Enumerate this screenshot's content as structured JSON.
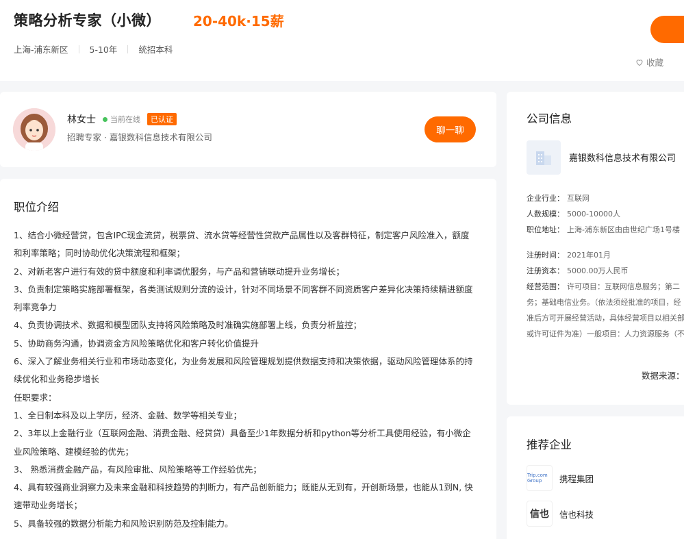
{
  "job": {
    "title": "策略分析专家（小微）",
    "salary": "20-40k·15薪",
    "location": "上海-浦东新区",
    "experience": "5-10年",
    "education": "统招本科",
    "favorite_label": "收藏"
  },
  "recruiter": {
    "name": "林女士",
    "status": "当前在线",
    "badge": "已认证",
    "subtitle": "招聘专家 · 嘉银数科信息技术有限公司",
    "chat_label": "聊一聊"
  },
  "description": {
    "title": "职位介绍",
    "lines": [
      "1、结合小微经营贷，包含IPC现金流贷，税票贷、流水贷等经营性贷款产品属性以及客群特征，制定客户风险准入，额度和利率策略；同时协助优化决策流程和框架；",
      "2、对新老客户进行有效的贷中额度和利率调优服务，与产品和营销联动提升业务增长；",
      "3、负责制定策略实施部署框架，各类测试规则分流的设计，针对不同场景不同客群不同资质客户差异化决策持续精进额度利率竞争力",
      "4、负责协调技术、数据和模型团队支持将风险策略及时准确实施部署上线，负责分析监控；",
      "5、协助商务沟通，协调资金方风险策略优化和客户转化价值提升",
      "6、深入了解业务相关行业和市场动态变化，为业务发展和风险管理规划提供数据支持和决策依据，驱动风险管理体系的持续优化和业务稳步增长",
      "任职要求：",
      "1、全日制本科及以上学历，经济、金融、数学等相关专业；",
      "2、3年以上金融行业（互联网金融、消费金融、经贷贷）具备至少1年数据分析和python等分析工具使用经验，有小微企业风险策略、建模经验的优先；",
      "3、 熟悉消费金融产品，有风险审批、风险策略等工作经验优先；",
      "4、具有较强商业洞察力及未来金融和科技趋势的判断力，有产品创新能力；既能从无到有，开创新场景，也能从1到N, 快速带动业务增长；",
      "5、具备较强的数据分析能力和风险识别防范及控制能力。"
    ]
  },
  "company": {
    "title": "公司信息",
    "name": "嘉银数科信息技术有限公司",
    "industry_label": "企业行业：",
    "industry": "互联网",
    "size_label": "人数规模：",
    "size": "5000-10000人",
    "address_label": "职位地址：",
    "address": "上海-浦东新区由由世纪广场1号楼",
    "reg_date_label": "注册时间：",
    "reg_date": "2021年01月",
    "capital_label": "注册资本：",
    "capital": "5000.00万人民币",
    "scope_label": "经营范围：",
    "scope_lines": [
      "许可项目：互联网信息服务；第二",
      "务；基础电信业务。（依法须经批准的项目，经",
      "准后方可开展经营活动，具体经营项目以相关部",
      "或许可证件为准）一般项目：人力资源服务（不"
    ],
    "source": "数据来源："
  },
  "recommend": {
    "title": "推荐企业",
    "items": [
      {
        "name": "携程集团",
        "logo_text": "Trip.com Group"
      },
      {
        "name": "信也科技",
        "logo_text": "信也"
      }
    ]
  }
}
